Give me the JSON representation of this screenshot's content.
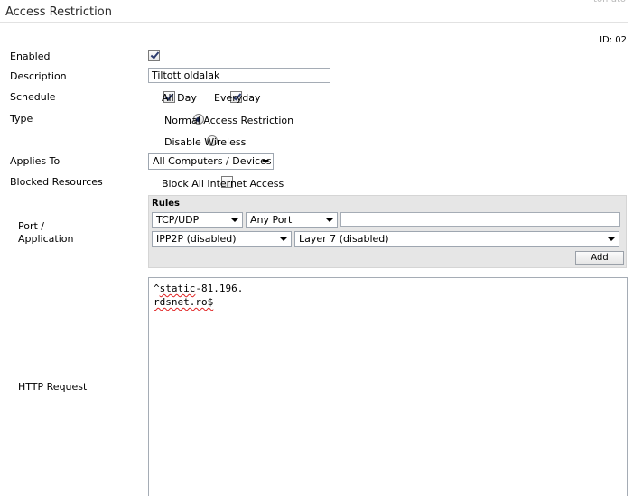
{
  "brand": "tomato",
  "page": {
    "title": "Access Restriction",
    "id_label": "ID: 02"
  },
  "labels": {
    "enabled": "Enabled",
    "description": "Description",
    "schedule": "Schedule",
    "type": "Type",
    "applies_to": "Applies To",
    "blocked_resources": "Blocked Resources",
    "port_application_1": "Port /",
    "port_application_2": "Application",
    "http_request": "HTTP Request"
  },
  "form": {
    "enabled": true,
    "description_value": "Tiltott oldalak",
    "schedule": {
      "all_day_label": "All Day",
      "all_day": true,
      "everyday_label": "Everyday",
      "everyday": true
    },
    "type_options": [
      {
        "label": "Normal Access Restriction",
        "selected": true
      },
      {
        "label": "Disable Wireless",
        "selected": false
      }
    ],
    "applies_to_value": "All Computers / Devices",
    "block_all_label": "Block All Internet Access",
    "block_all": false
  },
  "rules": {
    "header": "Rules",
    "protocol_value": "TCP/UDP",
    "port_value": "Any Port",
    "port_text_value": "",
    "ipp2p_value": "IPP2P (disabled)",
    "layer7_value": "Layer 7 (disabled)",
    "add_label": "Add"
  },
  "http_request": {
    "line1_prefix": "^",
    "line1_word": "static",
    "line1_rest": "-81.196.",
    "line2": "rdsnet.ro$"
  },
  "icons": {
    "dropdown": "chevron-down-icon",
    "check": "check-icon"
  }
}
